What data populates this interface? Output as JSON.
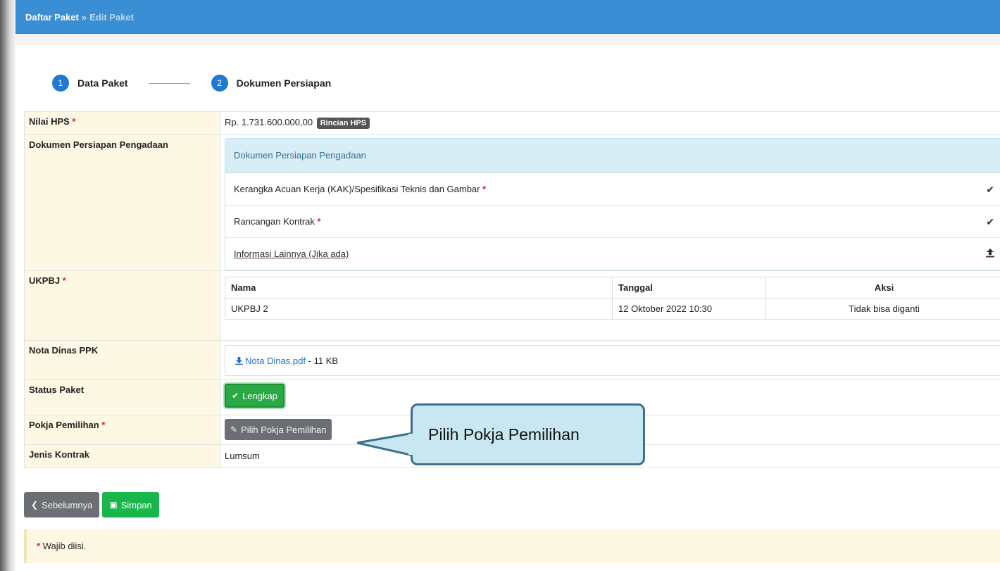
{
  "breadcrumb": {
    "root": "Daftar Paket",
    "separator": "»",
    "current": "Edit Paket"
  },
  "stepper": [
    {
      "number": "1",
      "label": "Data Paket"
    },
    {
      "number": "2",
      "label": "Dokumen Persiapan"
    }
  ],
  "required_mark": "*",
  "nilai_hps": {
    "label": "Nilai HPS",
    "value": "Rp. 1.731.600.000,00",
    "badge": "Rincian HPS"
  },
  "dokumen": {
    "label": "Dokumen Persiapan Pengadaan",
    "panel_title": "Dokumen Persiapan Pengadaan",
    "items": [
      {
        "label": "Kerangka Acuan Kerja (KAK)/Spesifikasi Teknis dan Gambar",
        "icon": "check-icon"
      },
      {
        "label": "Rancangan Kontrak",
        "icon": "check-icon"
      },
      {
        "label": "Informasi Lainnya (Jika ada)",
        "icon": "upload-icon"
      }
    ]
  },
  "ukpbj": {
    "label": "UKPBJ",
    "columns": {
      "nama": "Nama",
      "tanggal": "Tanggal",
      "aksi": "Aksi"
    },
    "rows": [
      {
        "nama": "UKPBJ 2",
        "tanggal": "12 Oktober 2022 10:30",
        "aksi": "Tidak bisa diganti"
      }
    ]
  },
  "nota_dinas": {
    "label": "Nota Dinas PPK",
    "file_name": "Nota Dinas.pdf",
    "size": "- 11 KB"
  },
  "status_paket": {
    "label": "Status Paket",
    "button": "Lengkap"
  },
  "pokja": {
    "label": "Pokja Pemilihan",
    "button": "Pilih Pokja Pemilihan"
  },
  "jenis_kontrak": {
    "label": "Jenis Kontrak",
    "value": "Lumsum"
  },
  "actions": {
    "back": "Sebelumnya",
    "save": "Simpan"
  },
  "note": {
    "text": "Wajib diisi."
  },
  "callout": {
    "text": "Pilih Pokja Pemilihan"
  },
  "colors": {
    "header": "#3a8ed3",
    "label_bg": "#fcf8e3",
    "success": "#2aa846",
    "step": "#1f78d1",
    "callout_bg": "#c9e7f1"
  }
}
